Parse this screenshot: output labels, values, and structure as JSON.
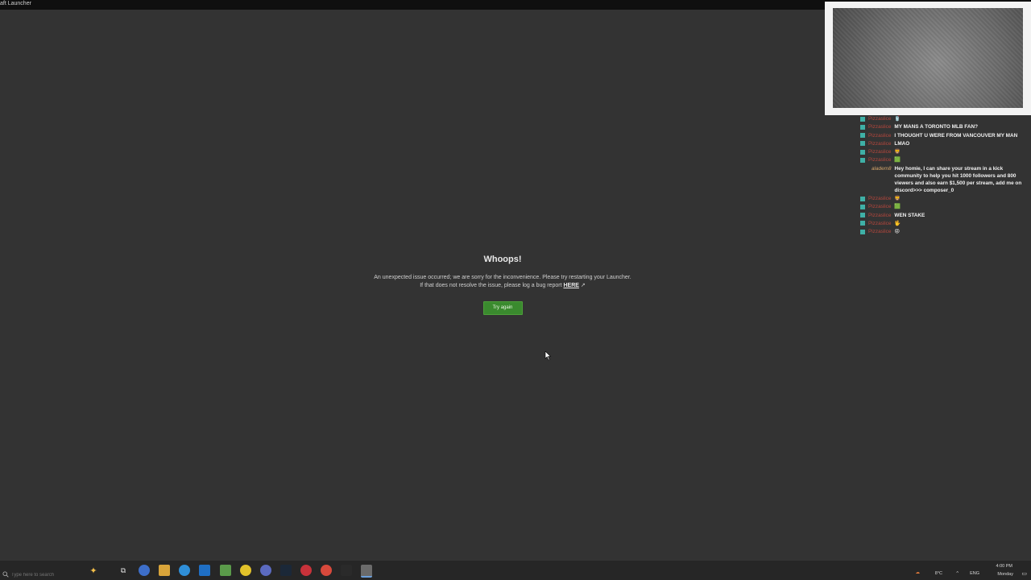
{
  "window": {
    "title": "aft Launcher"
  },
  "error": {
    "title": "Whoops!",
    "message_line1": "An unexpected issue occurred; we are sorry for the inconvenience. Please try restarting your Launcher.",
    "message_line2_prefix": "If that does not resolve the issue, please log a bug report",
    "link_label": "HERE",
    "button_label": "Try again"
  },
  "chat": {
    "messages": [
      {
        "user": "Pizzaslice",
        "text": "🥤"
      },
      {
        "user": "Pizzaslice",
        "text": "MY MANS A TORONTO MLB FAN?"
      },
      {
        "user": "Pizzaslice",
        "text": "I THOUGHT U WERE FROM VANCOUVER MY MAN"
      },
      {
        "user": "Pizzaslice",
        "text": "LMAO"
      },
      {
        "user": "Pizzaslice",
        "text": "🦁"
      },
      {
        "user": "Pizzaslice",
        "text": "🟩"
      },
      {
        "user": "aladem8",
        "text": "Hey homie, I can share your stream in a kick community to help you hit 1000 followers and 800 viewers and also earn $1,500 per stream, add me on discord>>> composer_0"
      },
      {
        "user": "Pizzaslice",
        "text": "🦁"
      },
      {
        "user": "Pizzaslice",
        "text": "🟩"
      },
      {
        "user": "Pizzaslice",
        "text": "WEN STAKE"
      },
      {
        "user": "Pizzaslice",
        "text": "🖖"
      },
      {
        "user": "Pizzaslice",
        "text": "😡"
      }
    ]
  },
  "taskbar": {
    "search_placeholder": "Type here to search",
    "weather": "8°C",
    "language": "ENG",
    "time": "4:00 PM",
    "day": "Monday",
    "apps": [
      "copilot",
      "task-view",
      "chrome",
      "file-explorer",
      "edge",
      "outlook",
      "xbox",
      "norton",
      "browser",
      "steam",
      "opera",
      "chrome-alt",
      "epic-games",
      "minecraft-launcher"
    ]
  },
  "colors": {
    "background": "#333333",
    "button_green": "#3a8a2e",
    "chat_user": "#b5473d",
    "chat_badge": "#3fb0a6"
  }
}
